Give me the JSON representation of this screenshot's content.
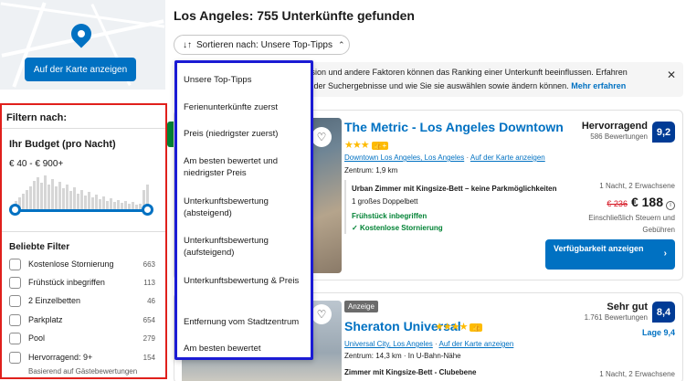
{
  "map": {
    "button_label": "Auf der Karte anzeigen"
  },
  "filters": {
    "title": "Filtern nach:",
    "budget_title": "Ihr Budget (pro Nacht)",
    "budget_range": "€ 40 - € 900+",
    "popular_title": "Beliebte Filter",
    "items": [
      {
        "label": "Kostenlose Stornierung",
        "count": "663"
      },
      {
        "label": "Frühstück inbegriffen",
        "count": "113"
      },
      {
        "label": "2 Einzelbetten",
        "count": "46"
      },
      {
        "label": "Parkplatz",
        "count": "654"
      },
      {
        "label": "Pool",
        "count": "279"
      },
      {
        "label": "Hervorragend: 9+",
        "count": "154"
      }
    ],
    "item_sub": "Basierend auf Gästebewertungen"
  },
  "main": {
    "heading": "Los Angeles: 755 Unterkünfte gefunden",
    "sort_label": "Sortieren nach: Unsere Top-Tipps",
    "info_line1": "ssion und andere Faktoren können das Ranking einer Unterkunft beeinflussen. Erfahren",
    "info_line2": "n der Suchergebnisse und wie Sie sie auswählen sowie ändern können.",
    "info_link": "Mehr erfahren"
  },
  "dropdown": {
    "options": [
      "Unsere Top-Tipps",
      "Ferienunterkünfte zuerst",
      "Preis (niedrigster zuerst)",
      "Am besten bewertet und niedrigster Preis",
      "Unterkunftsbewertung (absteigend)",
      "Unterkunftsbewertung (aufsteigend)",
      "Unterkunftsbewertung & Preis",
      "Entfernung vom Stadtzentrum",
      "Am besten bewertet"
    ]
  },
  "hotels": [
    {
      "name": "The Metric - Los Angeles Downtown",
      "stars": "★★★",
      "location_link": "Downtown Los Angeles, Los Angeles",
      "map_link": "Auf der Karte anzeigen",
      "distance": "Zentrum: 1,9 km",
      "room_name": "Urban Zimmer mit Kingsize-Bett – keine Parkmöglichkeiten",
      "room_bed": "1 großes Doppelbett",
      "breakfast": "Frühstück inbegriffen",
      "cancellation": "Kostenlose Stornierung",
      "rating_word": "Hervorragend",
      "rating_count": "586 Bewertungen",
      "score": "9,2",
      "nights": "1 Nacht, 2 Erwachsene",
      "old_price": "€ 236",
      "new_price": "€ 188",
      "tax_line1": "Einschließlich Steuern und",
      "tax_line2": "Gebühren",
      "cta": "Verfügbarkeit anzeigen"
    },
    {
      "ad": "Anzeige",
      "name": "Sheraton Universal",
      "stars": "★★★★",
      "location_link": "Universal City, Los Angeles",
      "map_link": "Auf der Karte anzeigen",
      "distance": "Zentrum: 14,3 km · In U-Bahn-Nähe",
      "room_name": "Zimmer mit Kingsize-Bett - Clubebene",
      "rating_word": "Sehr gut",
      "rating_count": "1.761 Bewertungen",
      "score": "8,4",
      "location_score": "Lage 9,4",
      "nights": "1 Nacht, 2 Erwachsene"
    }
  ]
}
